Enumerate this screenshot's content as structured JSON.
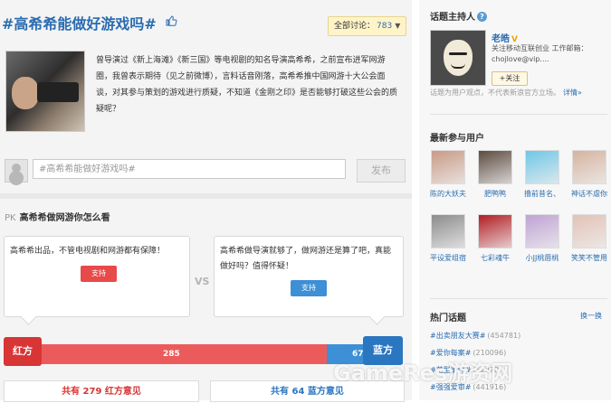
{
  "topic": {
    "title": "#高希希能做好游戏吗#",
    "discussion_label": "全部讨论：",
    "discussion_count": "783",
    "description": "曾导演过《新上海滩》《新三国》等电视剧的知名导演高希希，之前宣布进军网游圈，我曾表示期待（见之前微博），言料话音刚落，高希希推中国网游十大公会面谈，对其参与策划的游戏进行质疑，不知道《金刚之印》是否能够打破这些公会的质疑呢？"
  },
  "composer": {
    "input_value": "#高希希能做好游戏吗#",
    "post_label": "发布"
  },
  "pk": {
    "prefix": "PK",
    "title": "高希希做网游你怎么看",
    "vs_label": "VS",
    "red": {
      "question": "高希希出品，不管电视剧和网游都有保障！",
      "support_label": "支持",
      "flag_label": "红方",
      "votes": "285",
      "opinions": "共有 279 红方意见"
    },
    "blue": {
      "question": "高希希做导演就够了，做网游还是算了吧，真能做好吗？值得怀疑！",
      "support_label": "支持",
      "flag_label": "蓝方",
      "votes": "67",
      "opinions": "共有 64 蓝方意见"
    },
    "red_share": 0.81
  },
  "sidebar": {
    "moderator_heading": "话题主持人",
    "moderator_name": "老皓",
    "moderator_desc": "关注移动互联创业 工作邮箱：chojlove@vip....",
    "follow_label": "+关注",
    "moderator_note": "话题为用户观点，不代表新浪官方立场。",
    "detail_link": "详情»",
    "participants_heading": "最新参与用户",
    "users": [
      {
        "name": "陈的大妖夫",
        "color": "#c99a86"
      },
      {
        "name": "肥鸭鸭",
        "color": "#5d4b3f"
      },
      {
        "name": "撸前昔名、",
        "color": "#6fc7e6"
      },
      {
        "name": "神话不虐你",
        "color": "#d6b3a0"
      },
      {
        "name": "平设爱组宿",
        "color": "#8c8c8c"
      },
      {
        "name": "七彩魂牛",
        "color": "#b21d23"
      },
      {
        "name": "小JJ桃唇桃",
        "color": "#bfa2d4"
      },
      {
        "name": "笑笑不管用",
        "color": "#e2c2b5"
      }
    ],
    "hot_heading": "热门话题",
    "refresh_label": "换一换",
    "hot_topics": [
      {
        "name": "#出卖朋友大赛#",
        "count": "(454781)"
      },
      {
        "name": "#爱你每案#",
        "count": "(210096)"
      },
      {
        "name": "#范型事件#",
        "count": "(52978)"
      },
      {
        "name": "#强强爱审#",
        "count": "(441916)"
      }
    ]
  },
  "watermark": {
    "text_en": "GameRes",
    "text_cn": "游资网"
  },
  "icons": {
    "thumb": "thumbs-up-icon",
    "help": "question-icon",
    "verified": "verified-v-icon",
    "caret": "caret-down-icon"
  },
  "colors": {
    "link_blue": "#2a6cb0",
    "red_side": "#ec5b5b",
    "blue_side": "#3d8fd6",
    "badge_bg": "#fff4c8"
  }
}
